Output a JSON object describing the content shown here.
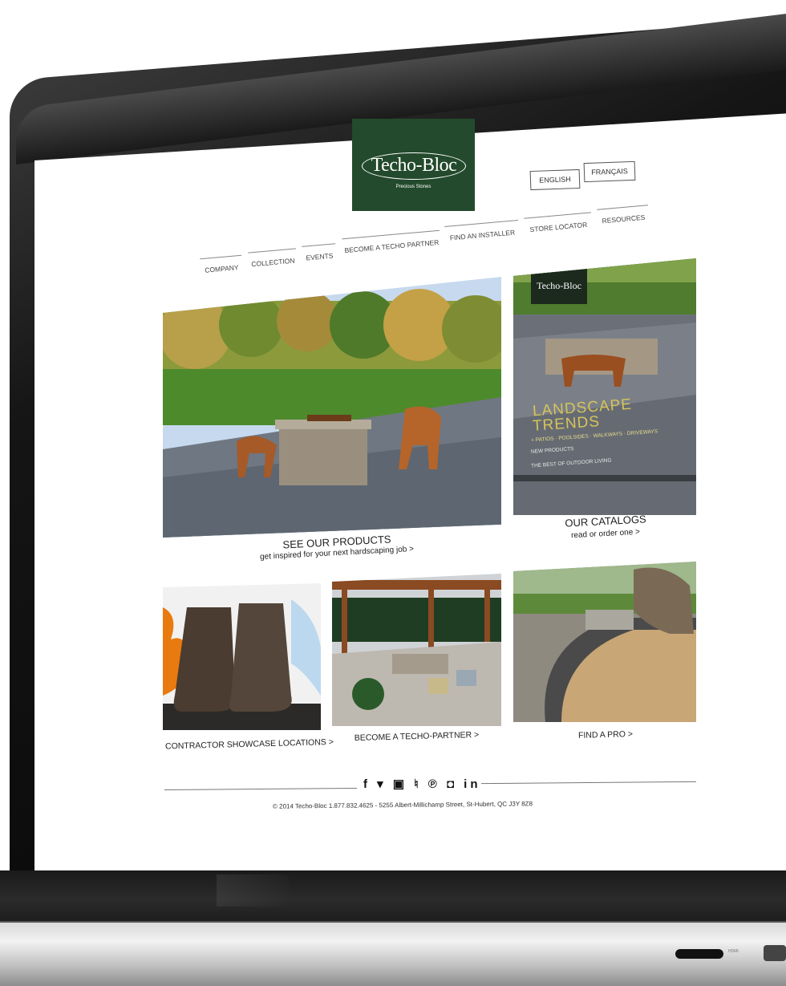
{
  "brand": {
    "logo_text": "Techo-Bloc",
    "tagline": "Precious Stones",
    "color": "#234a2c"
  },
  "languages": [
    "ENGLISH",
    "FRANÇAIS"
  ],
  "nav": [
    "COMPANY",
    "COLLECTION",
    "EVENTS",
    "BECOME A TECHO PARTNER",
    "FIND AN INSTALLER",
    "STORE LOCATOR",
    "RESOURCES"
  ],
  "hero": {
    "title": "SEE OUR PRODUCTS",
    "subtitle": "get inspired for your next hardscaping job >"
  },
  "catalog": {
    "title": "OUR CATALOGS",
    "subtitle": "read or order one >",
    "cover_logo": "Techo-Bloc",
    "cover_heading": [
      "LANDSCAPE",
      "TRENDS"
    ],
    "cover_lines": [
      "+ PATIOS · POOLSIDES · WALKWAYS · DRIVEWAYS",
      "NEW PRODUCTS",
      "THE BEST OF OUTDOOR LIVING"
    ]
  },
  "tiles": [
    {
      "label": "CONTRACTOR SHOWCASE LOCATIONS >"
    },
    {
      "label": "BECOME A TECHO-PARTNER >"
    },
    {
      "label": "FIND A PRO >"
    }
  ],
  "social_icons": [
    "facebook-icon",
    "twitter-icon",
    "youtube-icon",
    "houzz-icon",
    "pinterest-icon",
    "instagram-icon",
    "linkedin-icon"
  ],
  "social_glyphs": "f ▾ ▣ ♮ ℗ ◘ in",
  "footer": {
    "copyright": "© 2014 Techo-Bloc  1.877.832.4625 - 5255 Albert-Millichamp Street, St-Hubert, QC J3Y 8Z8"
  },
  "device_port_label": "HDMI"
}
